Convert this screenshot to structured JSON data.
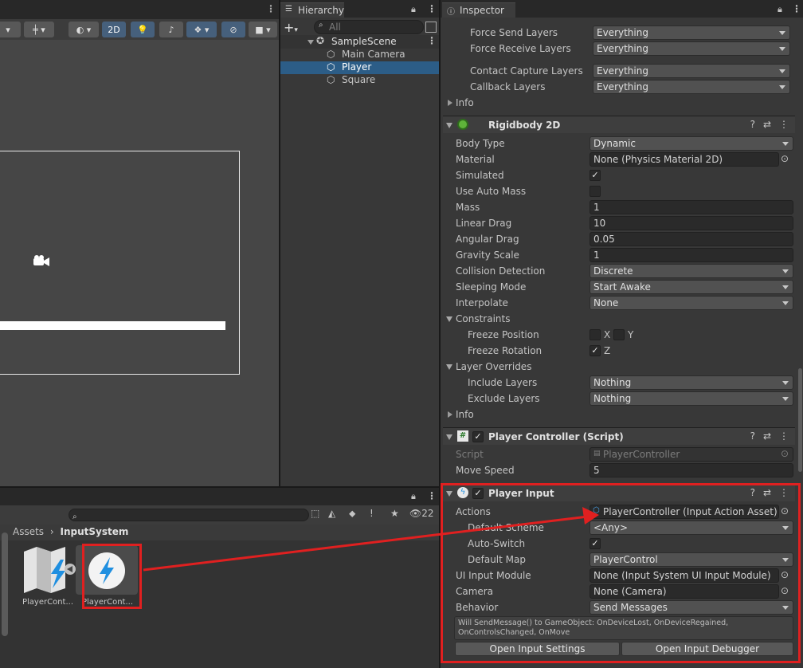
{
  "scene_toolbar": {
    "btn_2d": "2D"
  },
  "hierarchy": {
    "tab": "Hierarchy",
    "search_placeholder": "All",
    "scene": "SampleScene",
    "items": [
      {
        "label": "Main Camera"
      },
      {
        "label": "Player"
      },
      {
        "label": "Square"
      }
    ]
  },
  "inspector": {
    "tab": "Inspector",
    "top_rows": [
      {
        "label": "Force Send Layers",
        "value": "Everything"
      },
      {
        "label": "Force Receive Layers",
        "value": "Everything"
      },
      {
        "label": "Contact Capture Layers",
        "value": "Everything"
      },
      {
        "label": "Callback Layers",
        "value": "Everything"
      }
    ],
    "info1": "Info",
    "rb": {
      "title": "Rigidbody 2D",
      "body_type": {
        "label": "Body Type",
        "value": "Dynamic"
      },
      "material": {
        "label": "Material",
        "value": "None (Physics Material 2D)"
      },
      "simulated": {
        "label": "Simulated"
      },
      "use_auto_mass": {
        "label": "Use Auto Mass"
      },
      "mass": {
        "label": "Mass",
        "value": "1"
      },
      "linear_drag": {
        "label": "Linear Drag",
        "value": "10"
      },
      "angular_drag": {
        "label": "Angular Drag",
        "value": "0.05"
      },
      "gravity_scale": {
        "label": "Gravity Scale",
        "value": "1"
      },
      "collision": {
        "label": "Collision Detection",
        "value": "Discrete"
      },
      "sleeping": {
        "label": "Sleeping Mode",
        "value": "Start Awake"
      },
      "interpolate": {
        "label": "Interpolate",
        "value": "None"
      },
      "constraints": "Constraints",
      "freeze_pos": {
        "label": "Freeze Position",
        "x": "X",
        "y": "Y"
      },
      "freeze_rot": {
        "label": "Freeze Rotation",
        "z": "Z"
      },
      "layer_overrides": "Layer Overrides",
      "include": {
        "label": "Include Layers",
        "value": "Nothing"
      },
      "exclude": {
        "label": "Exclude Layers",
        "value": "Nothing"
      },
      "info": "Info"
    },
    "pc": {
      "title": "Player Controller (Script)",
      "script": {
        "label": "Script",
        "value": "PlayerController"
      },
      "move_speed": {
        "label": "Move Speed",
        "value": "5"
      }
    },
    "pi": {
      "title": "Player Input",
      "actions": {
        "label": "Actions",
        "value": "PlayerController (Input Action Asset)"
      },
      "default_scheme": {
        "label": "Default Scheme",
        "value": "<Any>"
      },
      "auto_switch": {
        "label": "Auto-Switch"
      },
      "default_map": {
        "label": "Default Map",
        "value": "PlayerControl"
      },
      "ui_module": {
        "label": "UI Input Module",
        "value": "None (Input System UI Input Module)"
      },
      "camera": {
        "label": "Camera",
        "value": "None (Camera)"
      },
      "behavior": {
        "label": "Behavior",
        "value": "Send Messages"
      },
      "help": "Will SendMessage() to GameObject: OnDeviceLost, OnDeviceRegained, OnControlsChanged, OnMove",
      "btn_settings": "Open Input Settings",
      "btn_debugger": "Open Input Debugger"
    }
  },
  "project": {
    "breadcrumb_root": "Assets",
    "breadcrumb_folder": "InputSystem",
    "hidden_count": "22",
    "assets": [
      {
        "label": "PlayerCont..."
      },
      {
        "label": "PlayerCont..."
      }
    ]
  },
  "colors": {
    "annotation": "#e02020",
    "selection": "#2c5d87"
  }
}
